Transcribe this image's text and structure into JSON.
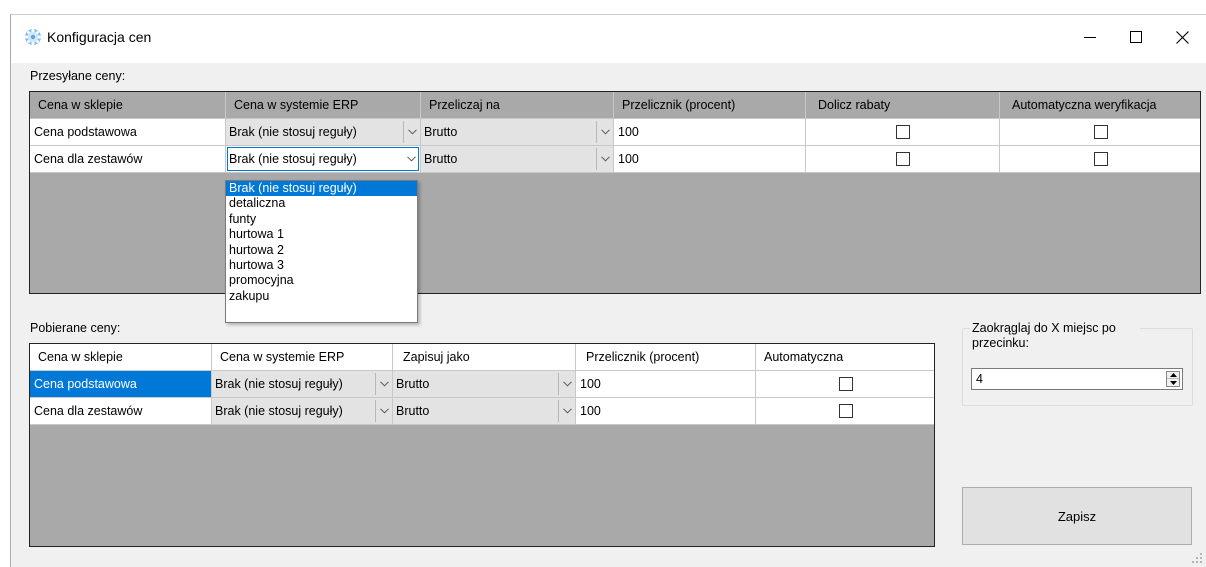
{
  "window": {
    "title": "Konfiguracja cen",
    "controls": [
      "minimize-icon",
      "maximize-icon",
      "close-icon"
    ]
  },
  "sent": {
    "label": "Przesyłane ceny:",
    "columns": [
      "Cena w sklepie",
      "Cena w systemie ERP",
      "Przeliczaj na",
      "Przelicznik (procent)",
      "Dolicz rabaty",
      "Automatyczna weryfikacja"
    ],
    "rows": [
      {
        "shop_price": "Cena podstawowa",
        "erp_price": "Brak (nie stosuj reguły)",
        "convert_to": "Brutto",
        "factor": "100",
        "add_discounts": false,
        "auto_verify": false
      },
      {
        "shop_price": "Cena dla zestawów",
        "erp_price": "Brak (nie stosuj reguły)",
        "convert_to": "Brutto",
        "factor": "100",
        "add_discounts": false,
        "auto_verify": false
      }
    ],
    "dropdown": {
      "open_on_row": 1,
      "selected": "Brak (nie stosuj reguły)",
      "options": [
        "Brak (nie stosuj reguły)",
        "detaliczna",
        "funty",
        "hurtowa 1",
        "hurtowa 2",
        "hurtowa 3",
        "promocyjna",
        "zakupu"
      ]
    }
  },
  "fetched": {
    "label": "Pobierane ceny:",
    "columns": [
      "Cena w sklepie",
      "Cena w systemie ERP",
      "Zapisuj jako",
      "Przelicznik (procent)",
      "Automatyczna"
    ],
    "rows": [
      {
        "shop_price": "Cena podstawowa",
        "erp_price": "Brak (nie stosuj reguły)",
        "save_as": "Brutto",
        "factor": "100",
        "automatic": false,
        "selected": true
      },
      {
        "shop_price": "Cena dla zestawów",
        "erp_price": "Brak (nie stosuj reguły)",
        "save_as": "Brutto",
        "factor": "100",
        "automatic": false,
        "selected": false
      }
    ]
  },
  "rounding": {
    "label": "Zaokrąglaj do X miejsc po przecinku:",
    "value": "4"
  },
  "save_label": "Zapisz",
  "colors": {
    "selection": "#0078d7",
    "grid_background": "#a9a9a9",
    "window_background": "#f0f0f0",
    "combo_background": "#e3e3e3"
  }
}
